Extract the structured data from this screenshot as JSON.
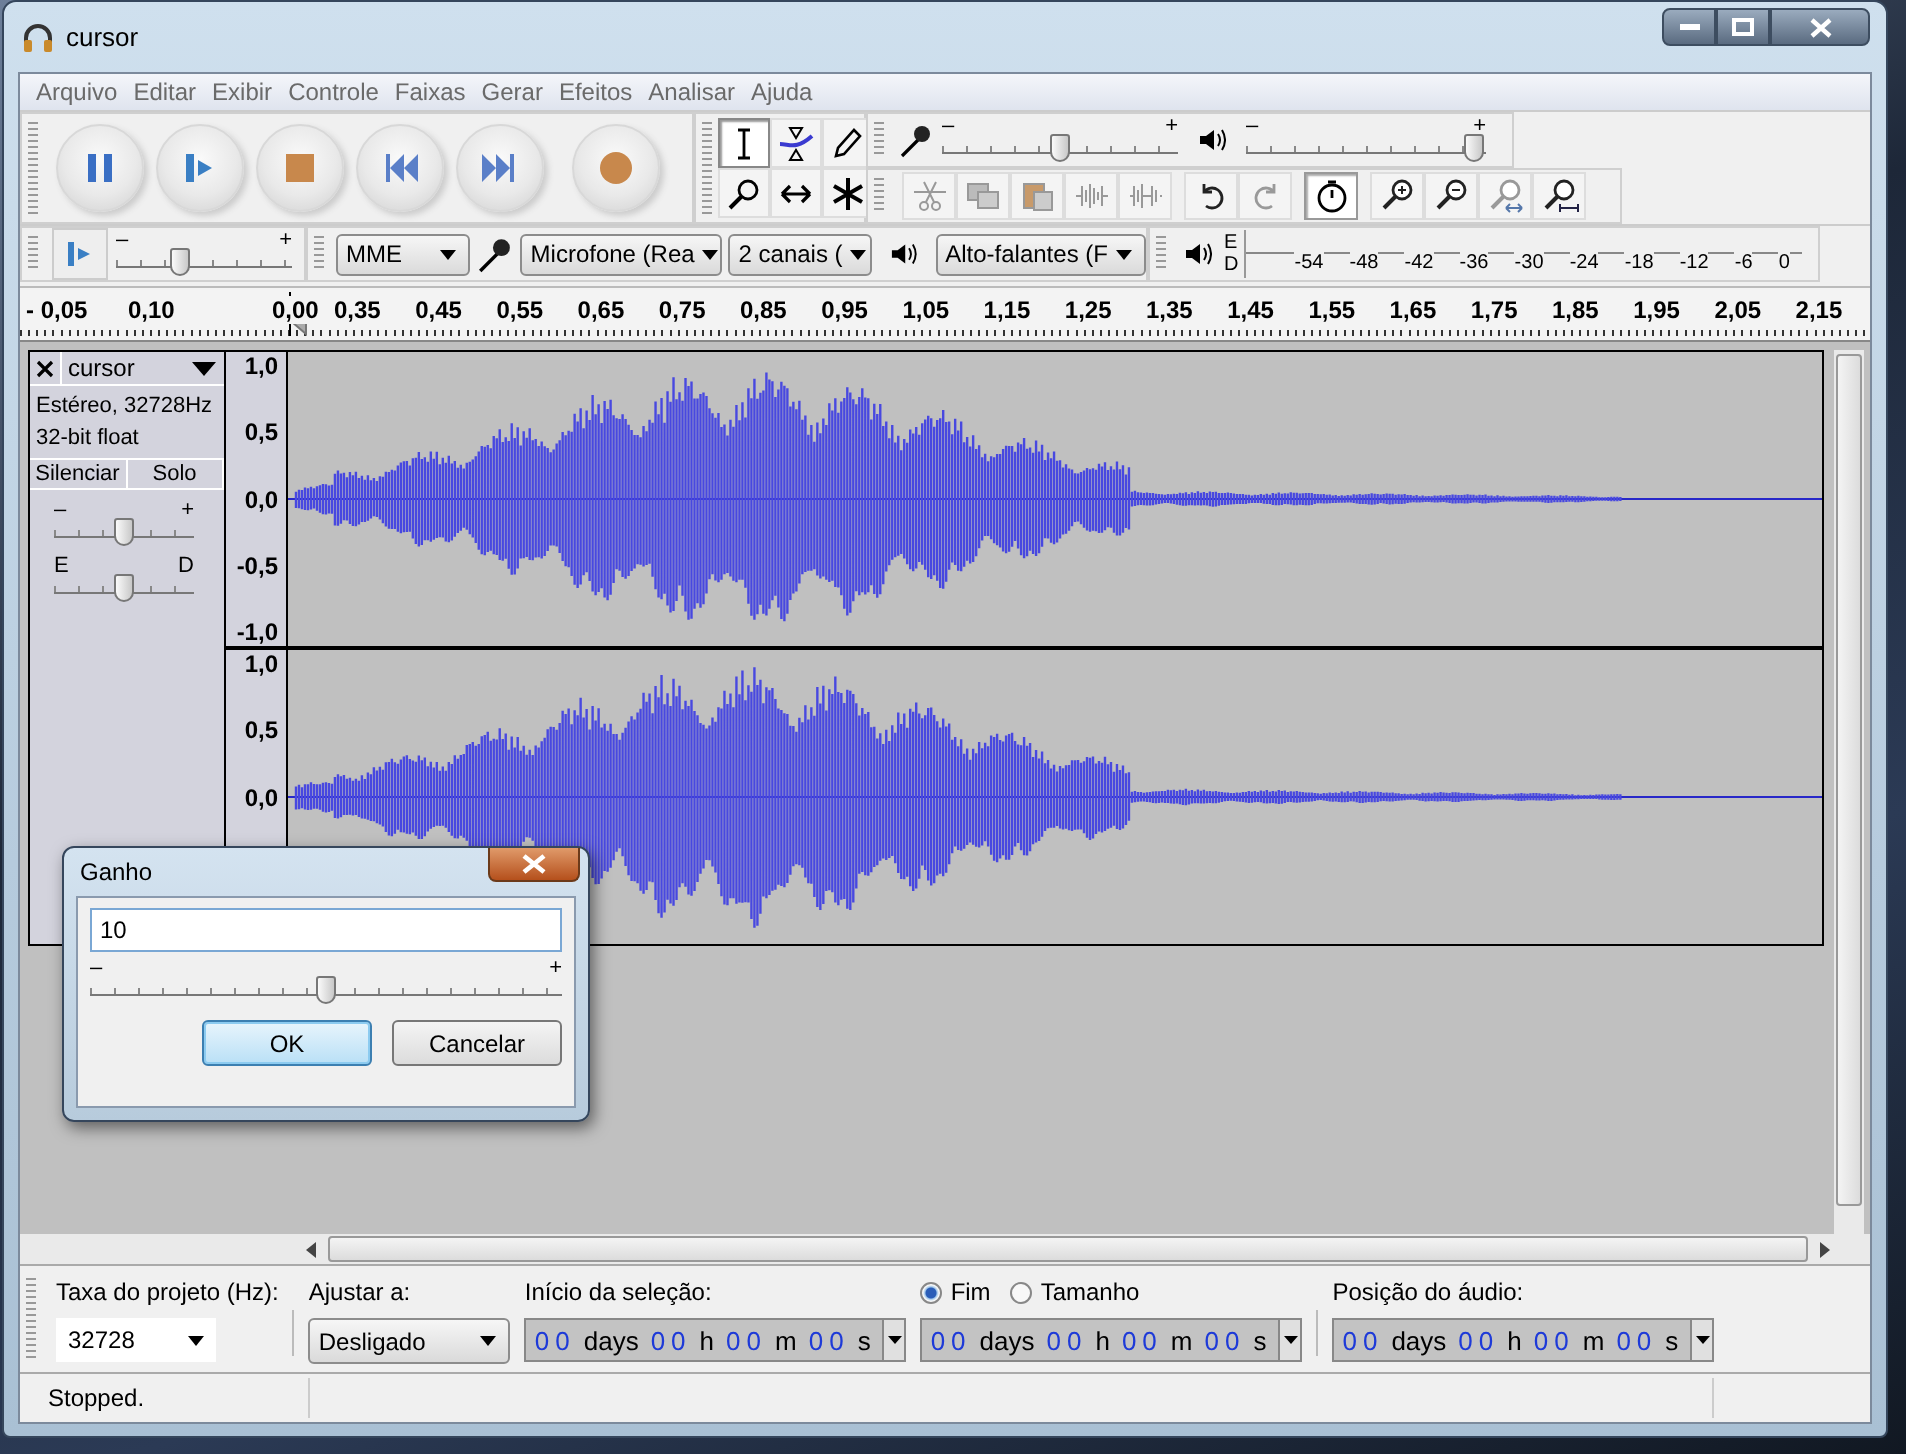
{
  "window": {
    "title": "cursor"
  },
  "menu": [
    "Arquivo",
    "Editar",
    "Exibir",
    "Controle",
    "Faixas",
    "Gerar",
    "Efeitos",
    "Analisar",
    "Ajuda"
  ],
  "transport": [
    {
      "kind": "pause"
    },
    {
      "kind": "play"
    },
    {
      "kind": "stop"
    },
    {
      "kind": "skip_start"
    },
    {
      "kind": "skip_end"
    },
    {
      "kind": "record"
    }
  ],
  "tools": [
    {
      "kind": "select",
      "selected": true
    },
    {
      "kind": "envelope",
      "selected": false
    },
    {
      "kind": "draw",
      "selected": false
    },
    {
      "kind": "zoom",
      "selected": false
    },
    {
      "kind": "timeshift",
      "selected": false
    },
    {
      "kind": "multi",
      "selected": false
    }
  ],
  "mixer": {
    "record": {
      "min_label": "–",
      "max_label": "+",
      "level": 0.5
    },
    "playback": {
      "min_label": "–",
      "max_label": "+",
      "level": 0.99
    }
  },
  "edit": [
    {
      "kind": "cut",
      "disabled": true
    },
    {
      "kind": "copy",
      "disabled": true
    },
    {
      "kind": "paste",
      "disabled": true
    },
    {
      "kind": "trim",
      "disabled": true
    },
    {
      "kind": "silence",
      "disabled": true
    }
  ],
  "history": [
    {
      "kind": "undo",
      "disabled": false
    },
    {
      "kind": "redo",
      "disabled": true
    }
  ],
  "sync_lock": {
    "on": true
  },
  "zoom": [
    {
      "kind": "zoom_in",
      "disabled": false
    },
    {
      "kind": "zoom_out",
      "disabled": false
    },
    {
      "kind": "fit_selection",
      "disabled": true
    },
    {
      "kind": "fit_project",
      "disabled": false
    }
  ],
  "play_at_speed": {
    "min_label": "–",
    "max_label": "+",
    "level": 0.35
  },
  "devices": {
    "host": "MME",
    "input": "Microfone (Rea",
    "channels": "2 canais (",
    "output": "Alto-falantes (F"
  },
  "meter": {
    "channels": [
      "E",
      "D"
    ],
    "scale": [
      "-54",
      "-48",
      "-42",
      "-36",
      "-30",
      "-24",
      "-18",
      "-12",
      "-6",
      "0"
    ]
  },
  "ruler": [
    "- 0,05",
    "0,10",
    "0,00",
    "0,35",
    "0,45",
    "0,55",
    "0,65",
    "0,75",
    "0,85",
    "0,95",
    "1,05",
    "1,15",
    "1,25",
    "1,35",
    "1,45",
    "1,55",
    "1,65",
    "1,75",
    "1,85",
    "1,95",
    "2,05",
    "2,15"
  ],
  "track": {
    "name": "cursor",
    "info": [
      "Estéreo, 32728Hz",
      "32-bit float"
    ],
    "buttons": [
      "Silenciar",
      "Solo"
    ],
    "gain": {
      "min_label": "–",
      "max_label": "+",
      "level": 0.5
    },
    "pan": {
      "min_label": "E",
      "max_label": "D",
      "level": 0.5
    },
    "channels": [
      {
        "scale": [
          "1,0",
          "0,5",
          "0,0",
          "-0,5",
          "-1,0"
        ]
      },
      {
        "scale": [
          "1,0",
          "0,5",
          "0,0"
        ]
      }
    ]
  },
  "dialog": {
    "title": "Ganho",
    "value": "10",
    "slider": {
      "min_label": "–",
      "max_label": "+",
      "level": 0.5
    },
    "buttons": [
      {
        "label": "OK",
        "default": true
      },
      {
        "label": "Cancelar",
        "default": false
      }
    ]
  },
  "selection_bar": {
    "rate": {
      "label": "Taxa do projeto (Hz):",
      "value": "32728"
    },
    "snap": {
      "label": "Ajustar a:",
      "value": "Desligado"
    },
    "start": {
      "label": "Início da seleção:",
      "time": [
        {
          "digits": "00",
          "unit": "days"
        },
        {
          "digits": "00",
          "unit": "h"
        },
        {
          "digits": "00",
          "unit": "m"
        },
        {
          "digits": "00",
          "unit": "s"
        }
      ]
    },
    "end_mode": [
      {
        "label": "Fim",
        "selected": true
      },
      {
        "label": "Tamanho",
        "selected": false
      }
    ],
    "end": {
      "time": [
        {
          "digits": "00",
          "unit": "days"
        },
        {
          "digits": "00",
          "unit": "h"
        },
        {
          "digits": "00",
          "unit": "m"
        },
        {
          "digits": "00",
          "unit": "s"
        }
      ]
    },
    "position": {
      "label": "Posição do áudio:",
      "time": [
        {
          "digits": "00",
          "unit": "days"
        },
        {
          "digits": "00",
          "unit": "h"
        },
        {
          "digits": "00",
          "unit": "m"
        },
        {
          "digits": "00",
          "unit": "s"
        }
      ]
    }
  },
  "status_bar": "Stopped."
}
